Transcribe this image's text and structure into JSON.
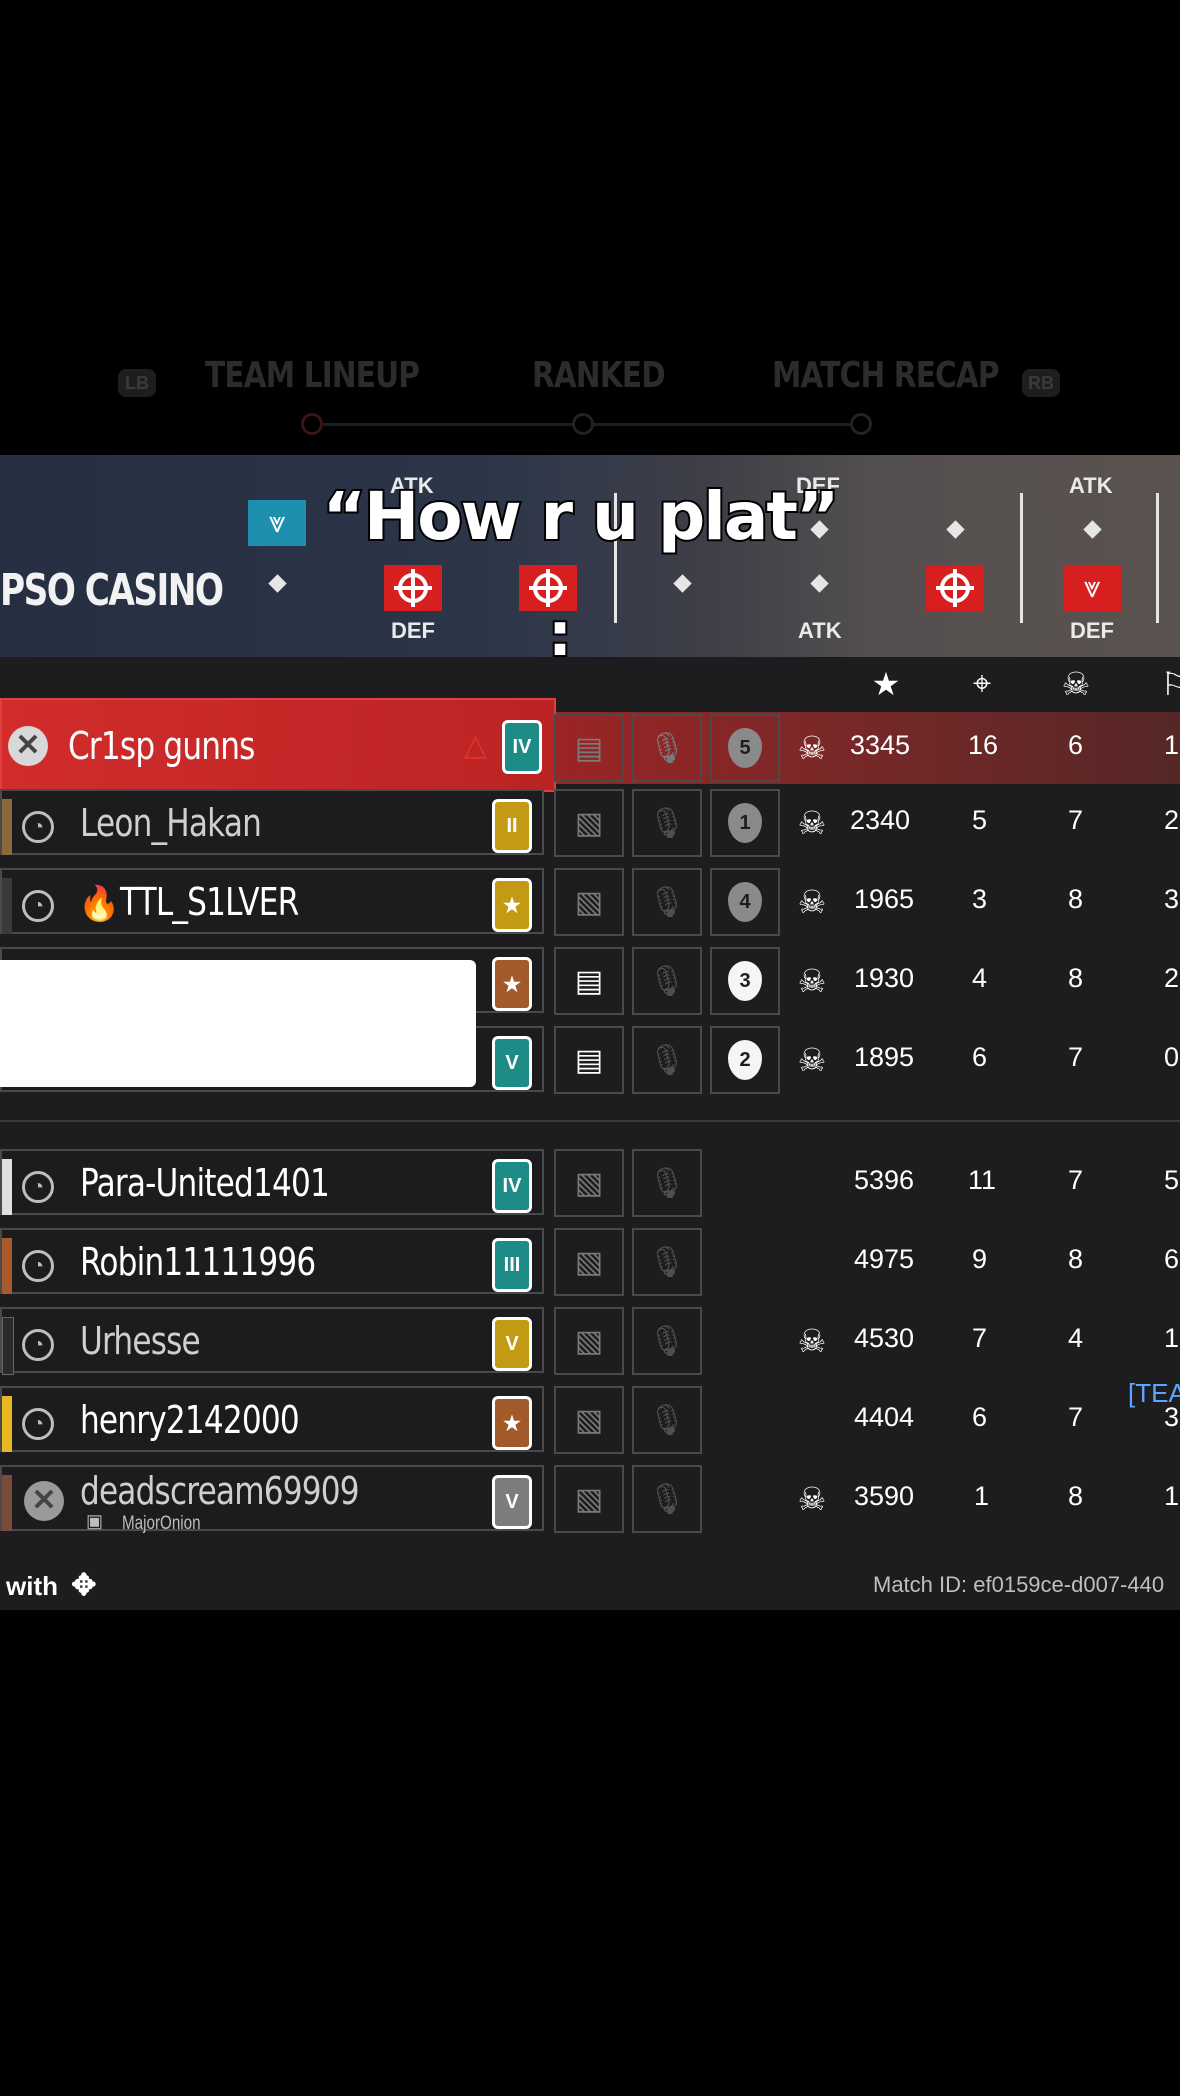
{
  "nav": {
    "lb": "LB",
    "rb": "RB",
    "tabs": [
      "TEAM LINEUP",
      "RANKED",
      "MATCH RECAP"
    ]
  },
  "banner": {
    "map_name": "PSO CASINO",
    "labels": {
      "atk1": "ATK",
      "def1": "DEF",
      "def2": "DEF",
      "atk2": "ATK",
      "atk3": "ATK",
      "def3": "DEF"
    }
  },
  "caption": {
    "text": "“How r u plat”",
    "colon": ":"
  },
  "stat_headers": [
    "★",
    "⌖",
    "☠",
    "⚐"
  ],
  "team1": [
    {
      "name": "Cr1sp gunns",
      "rank": "IV",
      "rank_color": "teal",
      "pin": "5",
      "pin_bright": false,
      "score": "3345",
      "kills": "16",
      "deaths": "6",
      "assists": "1",
      "chat_bright": false,
      "platform": "xbox",
      "op_icon": true
    },
    {
      "name": "Leon_Hakan",
      "rank": "II",
      "rank_color": "gold",
      "pin": "1",
      "pin_bright": false,
      "score": "2340",
      "kills": "5",
      "deaths": "7",
      "assists": "2",
      "chat_bright": false,
      "platform": "ubi",
      "op_icon": true
    },
    {
      "name": "TTL_S1LVER",
      "rank": "★",
      "rank_color": "gold",
      "pin": "4",
      "pin_bright": false,
      "score": "1965",
      "kills": "3",
      "deaths": "8",
      "assists": "3",
      "chat_bright": false,
      "platform": "ubi",
      "op_icon": true
    },
    {
      "name": "",
      "rank": "★",
      "rank_color": "bronze",
      "pin": "3",
      "pin_bright": true,
      "score": "1930",
      "kills": "4",
      "deaths": "8",
      "assists": "2",
      "chat_bright": true,
      "platform": "",
      "op_icon": true
    },
    {
      "name": "",
      "rank": "V",
      "rank_color": "teal",
      "pin": "2",
      "pin_bright": true,
      "score": "1895",
      "kills": "6",
      "deaths": "7",
      "assists": "0",
      "chat_bright": true,
      "platform": "",
      "op_icon": true
    }
  ],
  "team2": [
    {
      "name": "Para-United1401",
      "rank": "IV",
      "rank_color": "teal",
      "score": "5396",
      "kills": "11",
      "deaths": "7",
      "assists": "5",
      "op_icon": false
    },
    {
      "name": "Robin11111996",
      "rank": "III",
      "rank_color": "teal",
      "score": "4975",
      "kills": "9",
      "deaths": "8",
      "assists": "6",
      "op_icon": false
    },
    {
      "name": "Urhesse",
      "rank": "V",
      "rank_color": "gold",
      "score": "4530",
      "kills": "7",
      "deaths": "4",
      "assists": "1",
      "op_icon": true
    },
    {
      "name": "henry2142000",
      "rank": "★",
      "rank_color": "bronze",
      "score": "4404",
      "kills": "6",
      "deaths": "7",
      "assists": "3",
      "op_icon": false
    },
    {
      "name": "deadscream69909",
      "sub": "MajorOnion",
      "rank": "V",
      "rank_color": "silver",
      "score": "3590",
      "kills": "1",
      "deaths": "8",
      "assists": "1",
      "op_icon": true
    }
  ],
  "team_tag": "[TEA",
  "footer": {
    "left": "with",
    "match_id": "Match ID: ef0159ce-d007-440"
  }
}
